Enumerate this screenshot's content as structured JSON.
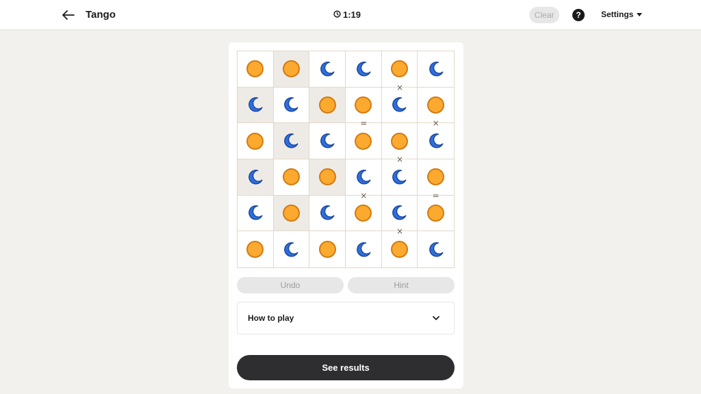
{
  "header": {
    "title": "Tango",
    "timer": "1:19",
    "clear_label": "Clear",
    "help_label": "?",
    "settings_label": "Settings"
  },
  "board": {
    "size": 6,
    "cells": [
      [
        "sun",
        "sun",
        "moon",
        "moon",
        "sun",
        "moon"
      ],
      [
        "moon",
        "moon",
        "sun",
        "sun",
        "moon",
        "sun"
      ],
      [
        "sun",
        "moon",
        "moon",
        "sun",
        "sun",
        "moon"
      ],
      [
        "moon",
        "sun",
        "sun",
        "moon",
        "moon",
        "sun"
      ],
      [
        "moon",
        "sun",
        "moon",
        "sun",
        "moon",
        "sun"
      ],
      [
        "sun",
        "moon",
        "sun",
        "moon",
        "sun",
        "moon"
      ]
    ],
    "locked": [
      [
        false,
        true,
        false,
        false,
        false,
        false
      ],
      [
        true,
        false,
        true,
        false,
        false,
        false
      ],
      [
        false,
        true,
        false,
        false,
        false,
        false
      ],
      [
        true,
        false,
        true,
        false,
        false,
        false
      ],
      [
        false,
        true,
        false,
        false,
        false,
        false
      ],
      [
        false,
        false,
        false,
        false,
        false,
        false
      ]
    ],
    "constraints": [
      {
        "type": "cross",
        "row": 0,
        "col": 4,
        "dir": "below",
        "symbol": "×"
      },
      {
        "type": "equal",
        "row": 1,
        "col": 3,
        "dir": "below",
        "symbol": "="
      },
      {
        "type": "cross",
        "row": 1,
        "col": 5,
        "dir": "below",
        "symbol": "×"
      },
      {
        "type": "cross",
        "row": 2,
        "col": 4,
        "dir": "below",
        "symbol": "×"
      },
      {
        "type": "cross",
        "row": 3,
        "col": 3,
        "dir": "below",
        "symbol": "×"
      },
      {
        "type": "equal",
        "row": 3,
        "col": 5,
        "dir": "below",
        "symbol": "="
      },
      {
        "type": "cross",
        "row": 4,
        "col": 4,
        "dir": "below",
        "symbol": "×"
      }
    ]
  },
  "controls": {
    "undo_label": "Undo",
    "hint_label": "Hint"
  },
  "howto": {
    "label": "How to play"
  },
  "results": {
    "label": "See results"
  },
  "colors": {
    "sun_fill": "#fba92f",
    "sun_stroke": "#d27b12",
    "moon_fill": "#2f6fdb",
    "moon_stroke": "#1b45a0",
    "locked_cell": "#eeebe6",
    "primary_button": "#2e2e30"
  }
}
